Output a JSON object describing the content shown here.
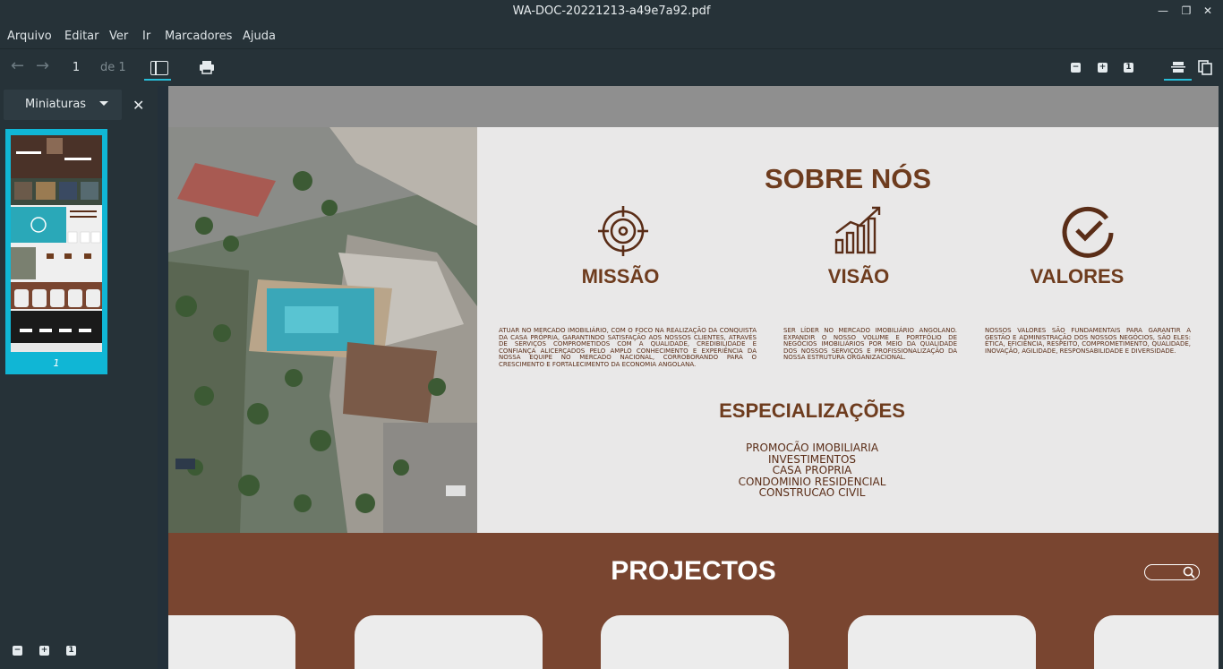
{
  "window": {
    "title": "WA-DOC-20221213-a49e7a92.pdf"
  },
  "menu": [
    "Arquivo",
    "Editar",
    "Ver",
    "Ir",
    "Marcadores",
    "Ajuda"
  ],
  "toolbar": {
    "page_current": "1",
    "page_total": "de 1"
  },
  "sidebar": {
    "title": "Miniaturas",
    "thumb_label": "1"
  },
  "doc": {
    "about_title": "SOBRE NÓS",
    "cols": [
      {
        "title": "MISSÃO",
        "text": "Atuar no mercado imobiliário, com o foco na realização da conquista da casa própria, garantindo satisfação aos nossos clientes, através de serviços comprometidos com a qualidade, credibilidade e confiança alicerçados pelo amplo conhecimento e experiência da nossa equipe no mercado nacional, corroborando para o crescimento e fortalecimento da economia angolana."
      },
      {
        "title": "VISÃO",
        "text": "Ser líder no mercado imobiliário angolano. Expandir o nosso volume e portfólio de negócios imobiliários por meio da qualidade dos nossos serviços e profissionalização da nossa estrutura organizacional."
      },
      {
        "title": "VALORES",
        "text": "Nossos valores são fundamentais para garantir a gestão e administração dos nossos negócios, são eles: ética, eficiência, respeito, comprometimento, qualidade, inovação, agilidade, responsabilidade e diversidade."
      }
    ],
    "spec_title": "ESPECIALIZAÇÕES",
    "specs": [
      "PROMOCÃO IMOBILIARIA",
      "INVESTIMENTOS",
      "CASA PROPRIA",
      "CONDOMINIO RESIDENCIAL",
      "CONSTRUCAO CIVIL"
    ],
    "projects_title": "PROJECTOS"
  },
  "colors": {
    "accent": "#10b6d5",
    "brown": "#794530",
    "text_brown": "#6e3c1e"
  }
}
